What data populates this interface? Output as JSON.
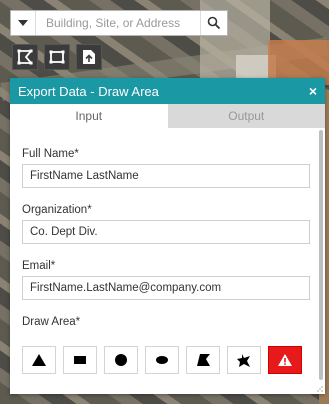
{
  "search": {
    "placeholder": "Building, Site, or Address"
  },
  "toolbar": {
    "icons": [
      "polygon-select-icon",
      "rectangle-select-icon",
      "export-icon"
    ]
  },
  "panel": {
    "title": "Export Data - Draw Area",
    "close_label": "×",
    "tabs": [
      {
        "label": "Input",
        "active": true
      },
      {
        "label": "Output",
        "active": false
      }
    ],
    "fields": [
      {
        "label": "Full Name*",
        "value": "FirstName LastName"
      },
      {
        "label": "Organization*",
        "value": "Co. Dept Div."
      },
      {
        "label": "Email*",
        "value": "FirstName.LastName@company.com"
      }
    ],
    "draw_area_label": "Draw Area*",
    "draw_tools": [
      "point-icon",
      "rectangle-icon",
      "circle-icon",
      "ellipse-icon",
      "polygon-icon",
      "freehand-icon",
      "clear-warning-icon"
    ]
  },
  "colors": {
    "header": "#1a98a3",
    "clear_button": "#e61a1a"
  }
}
